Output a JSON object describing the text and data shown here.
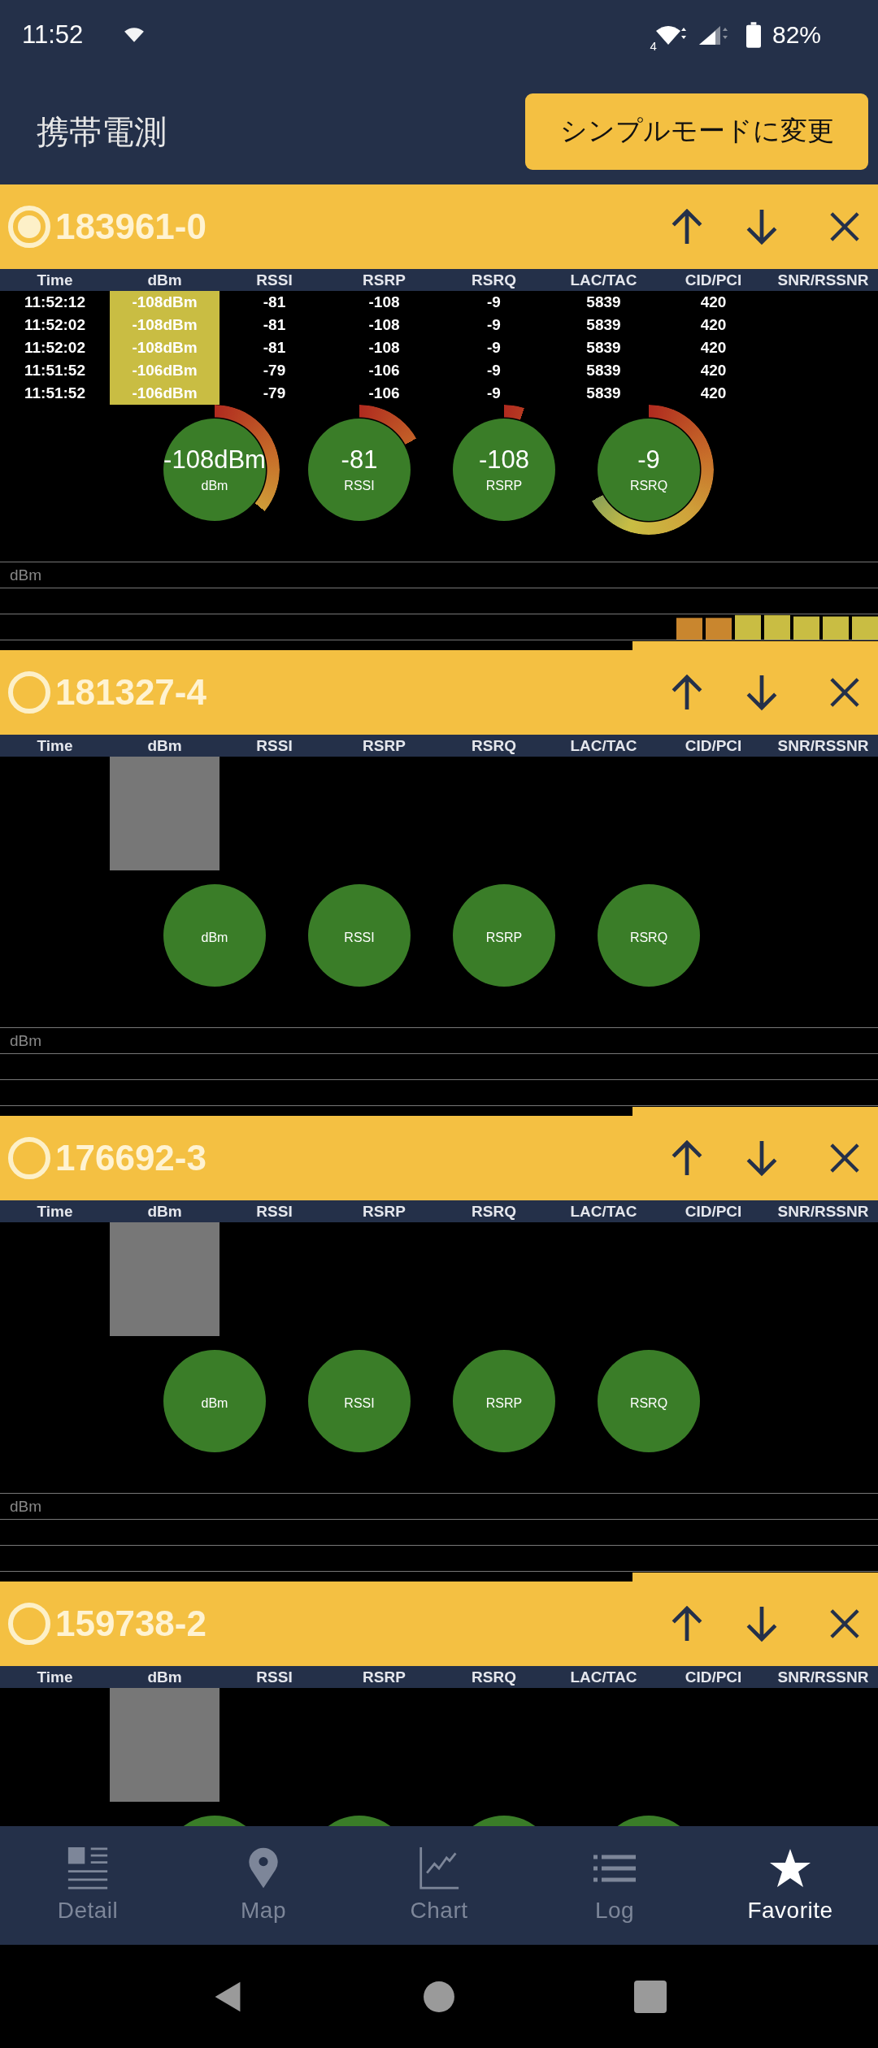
{
  "status_bar": {
    "time": "11:52",
    "wifi_badge": "4",
    "battery": "82%"
  },
  "app_bar": {
    "title": "携帯電測",
    "button": "シンプルモードに変更"
  },
  "cards": [
    {
      "id": "183961-0",
      "selected": true,
      "columns": [
        "Time",
        "dBm",
        "RSSI",
        "RSRP",
        "RSRQ",
        "LAC/TAC",
        "CID/PCI",
        "SNR/RSSNR"
      ],
      "rows": [
        [
          "11:52:12",
          "-108dBm",
          "-81",
          "-108",
          "-9",
          "5839",
          "420"
        ],
        [
          "11:52:02",
          "-108dBm",
          "-81",
          "-108",
          "-9",
          "5839",
          "420"
        ],
        [
          "11:52:02",
          "-108dBm",
          "-81",
          "-108",
          "-9",
          "5839",
          "420"
        ],
        [
          "11:51:52",
          "-106dBm",
          "-79",
          "-106",
          "-9",
          "5839",
          "420"
        ],
        [
          "11:51:52",
          "-106dBm",
          "-79",
          "-106",
          "-9",
          "5839",
          "420"
        ]
      ],
      "gauges": [
        {
          "kind": "value",
          "value": "-108dBm",
          "label": "dBm"
        },
        {
          "kind": "value",
          "value": "-81",
          "label": "RSSI"
        },
        {
          "kind": "value",
          "value": "-108",
          "label": "RSRP"
        },
        {
          "kind": "value",
          "value": "-9",
          "label": "RSRQ"
        }
      ],
      "chart_label": "dBm"
    },
    {
      "id": "181327-4",
      "selected": false,
      "columns": [
        "Time",
        "dBm",
        "RSSI",
        "RSRP",
        "RSRQ",
        "LAC/TAC",
        "CID/PCI",
        "SNR/RSSNR"
      ],
      "gauges": [
        {
          "kind": "blank",
          "label": "dBm"
        },
        {
          "kind": "blank",
          "label": "RSSI"
        },
        {
          "kind": "blank",
          "label": "RSRP"
        },
        {
          "kind": "blank",
          "label": "RSRQ"
        }
      ],
      "chart_label": "dBm"
    },
    {
      "id": "176692-3",
      "selected": false,
      "columns": [
        "Time",
        "dBm",
        "RSSI",
        "RSRP",
        "RSRQ",
        "LAC/TAC",
        "CID/PCI",
        "SNR/RSSNR"
      ],
      "gauges": [
        {
          "kind": "blank",
          "label": "dBm"
        },
        {
          "kind": "blank",
          "label": "RSSI"
        },
        {
          "kind": "blank",
          "label": "RSRP"
        },
        {
          "kind": "blank",
          "label": "RSRQ"
        }
      ],
      "chart_label": "dBm"
    },
    {
      "id": "159738-2",
      "selected": false,
      "columns": [
        "Time",
        "dBm",
        "RSSI",
        "RSRP",
        "RSRQ",
        "LAC/TAC",
        "CID/PCI",
        "SNR/RSSNR"
      ],
      "gauges": [
        {
          "kind": "blank"
        },
        {
          "kind": "blank"
        },
        {
          "kind": "blank"
        },
        {
          "kind": "blank"
        }
      ]
    }
  ],
  "nav": [
    {
      "label": "Detail",
      "selected": false
    },
    {
      "label": "Map",
      "selected": false
    },
    {
      "label": "Chart",
      "selected": false
    },
    {
      "label": "Log",
      "selected": false
    },
    {
      "label": "Favorite",
      "selected": true
    }
  ]
}
